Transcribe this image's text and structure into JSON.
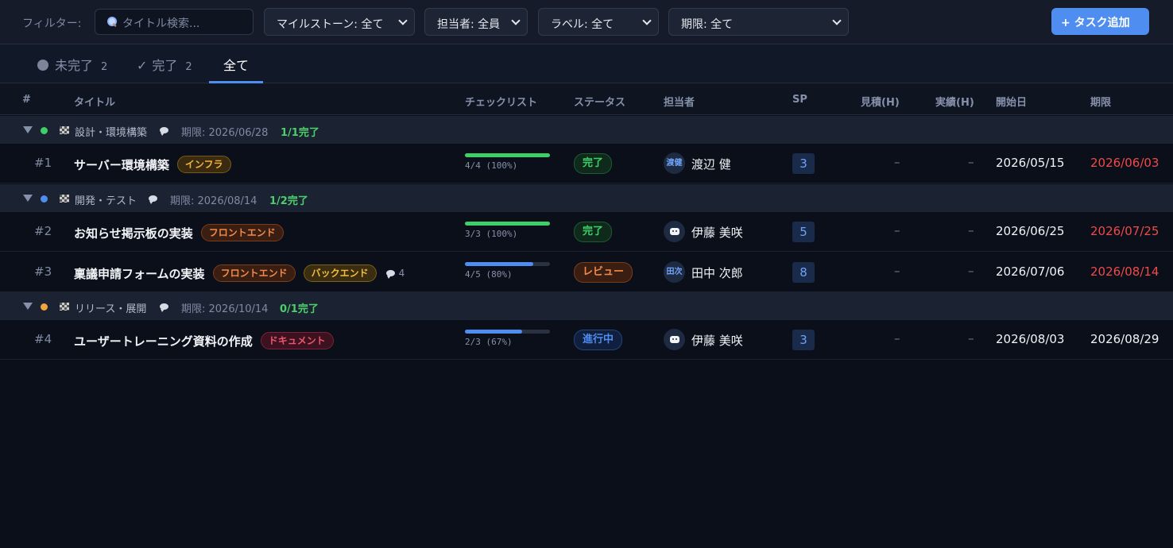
{
  "filterbar": {
    "label": "フィルター:",
    "search_placeholder": "タイトル検索...",
    "milestone": "マイルストーン: 全て",
    "assignee": "担当者: 全員",
    "label_filter": "ラベル: 全て",
    "due": "期限: 全て",
    "add_button": "+ タスク追加"
  },
  "tabs": [
    {
      "label": "未完了",
      "count": "2"
    },
    {
      "label": "完了",
      "count": "2"
    },
    {
      "label": "全て"
    }
  ],
  "columns": [
    "#",
    "タイトル",
    "チェックリスト",
    "ステータス",
    "担当者",
    "SP",
    "見積(H)",
    "実績(H)",
    "開始日",
    "期限"
  ],
  "groups": [
    {
      "name": "設計・環境構築",
      "due": "期限: 2026/06/28",
      "progress": "1/1完了",
      "dot_color": "#3dcf68"
    },
    {
      "name": "開発・テスト",
      "due": "期限: 2026/08/14",
      "progress": "1/2完了",
      "dot_color": "#4f8df0"
    },
    {
      "name": "リリース・展開",
      "due": "期限: 2026/10/14",
      "progress": "0/1完了",
      "dot_color": "#f2a33d"
    }
  ],
  "tasks": [
    {
      "num": "#1",
      "title": "サーバー環境構築",
      "labels": [
        "インフラ"
      ],
      "check_text": "4/4 (100%)",
      "check_fraction": 1.0,
      "status": "完了",
      "avatar": "渡健",
      "assignee": "渡辺 健",
      "sp": "3",
      "est": "–",
      "act": "–",
      "start": "2026/05/15",
      "due": "2026/06/03"
    },
    {
      "num": "#2",
      "title": "お知らせ掲示板の実装",
      "labels": [
        "フロントエンド"
      ],
      "check_text": "3/3 (100%)",
      "check_fraction": 1.0,
      "status": "完了",
      "avatar": "",
      "assignee": "伊藤 美咲",
      "sp": "5",
      "est": "–",
      "act": "–",
      "start": "2026/06/25",
      "due": "2026/07/25"
    },
    {
      "num": "#3",
      "title": "稟議申請フォームの実装",
      "labels": [
        "フロントエンド",
        "バックエンド"
      ],
      "comments": "4",
      "check_text": "4/5 (80%)",
      "check_fraction": 0.8,
      "status": "レビュー",
      "avatar": "田次",
      "assignee": "田中 次郎",
      "sp": "8",
      "est": "–",
      "act": "–",
      "start": "2026/07/06",
      "due": "2026/08/14"
    },
    {
      "num": "#4",
      "title": "ユーザートレーニング資料の作成",
      "labels": [
        "ドキュメント"
      ],
      "check_text": "2/3 (67%)",
      "check_fraction": 0.67,
      "status": "進行中",
      "avatar": "",
      "assignee": "伊藤 美咲",
      "sp": "3",
      "est": "–",
      "act": "–",
      "start": "2026/08/03",
      "due": "2026/08/29"
    }
  ],
  "colors": {
    "accent": "#4f8df0",
    "done": "#3dcf68",
    "overdue": "#f04a4a"
  }
}
